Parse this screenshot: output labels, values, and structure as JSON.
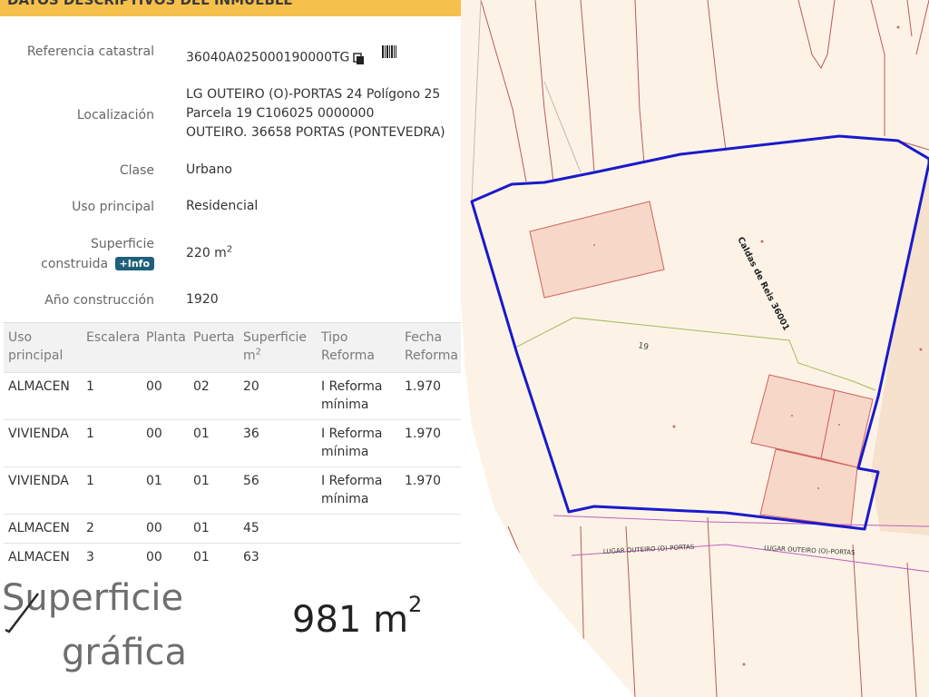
{
  "header": {
    "title": "DATOS DESCRIPTIVOS DEL INMUEBLE"
  },
  "properties": {
    "referencia": {
      "label": "Referencia catastral",
      "value": "36040A025000190000TG"
    },
    "localizacion": {
      "label": "Localización",
      "line1": "LG OUTEIRO (O)-PORTAS 24 Polígono 25",
      "line2": "Parcela 19 C106025 0000000",
      "line3": "OUTEIRO. 36658 PORTAS (PONTEVEDRA)"
    },
    "clase": {
      "label": "Clase",
      "value": "Urbano"
    },
    "uso": {
      "label": "Uso principal",
      "value": "Residencial"
    },
    "superficie": {
      "label_line1": "Superficie",
      "label_line2": "construida",
      "info_badge": "+Info",
      "value": "220 m",
      "unit_sup": "2"
    },
    "anio": {
      "label": "Año construcción",
      "value": "1920"
    }
  },
  "table": {
    "headers": {
      "uso": [
        "Uso",
        "principal"
      ],
      "escalera": "Escalera",
      "planta": "Planta",
      "puerta": "Puerta",
      "superficie": [
        "Superficie",
        "m",
        "2"
      ],
      "tipo": [
        "Tipo",
        "Reforma"
      ],
      "fecha": [
        "Fecha",
        "Reforma"
      ]
    },
    "rows": [
      {
        "uso": "ALMACEN",
        "escalera": "1",
        "planta": "00",
        "puerta": "02",
        "superficie": "20",
        "tipo1": "I Reforma",
        "tipo2": "mínima",
        "fecha": "1.970"
      },
      {
        "uso": "VIVIENDA",
        "escalera": "1",
        "planta": "00",
        "puerta": "01",
        "superficie": "36",
        "tipo1": "I Reforma",
        "tipo2": "mínima",
        "fecha": "1.970"
      },
      {
        "uso": "VIVIENDA",
        "escalera": "1",
        "planta": "01",
        "puerta": "01",
        "superficie": "56",
        "tipo1": "I Reforma",
        "tipo2": "mínima",
        "fecha": "1.970"
      },
      {
        "uso": "ALMACEN",
        "escalera": "2",
        "planta": "00",
        "puerta": "01",
        "superficie": "45",
        "tipo1": "",
        "tipo2": "",
        "fecha": ""
      },
      {
        "uso": "ALMACEN",
        "escalera": "3",
        "planta": "00",
        "puerta": "01",
        "superficie": "63",
        "tipo1": "",
        "tipo2": "",
        "fecha": ""
      }
    ]
  },
  "summary": {
    "label_line1": "Superficie",
    "label_line2": "gráfica",
    "value": "981 m",
    "unit_sup": "2"
  },
  "map": {
    "street_left": "LUGAR OUTEIRO (O)-PORTAS",
    "street_right": "LUGAR OUTEIRO (O)-PORTAS",
    "area_label": "Caldas de Reis 36001",
    "parcel_number": "19",
    "colors": {
      "background": "#fcf3e6",
      "parcel_outline": "#1a1acc",
      "building_fill": "#f7d8c8",
      "building_stroke": "#d06060",
      "cadastral_lines": "#b85a5a",
      "street_lines": "#c060c0"
    }
  }
}
